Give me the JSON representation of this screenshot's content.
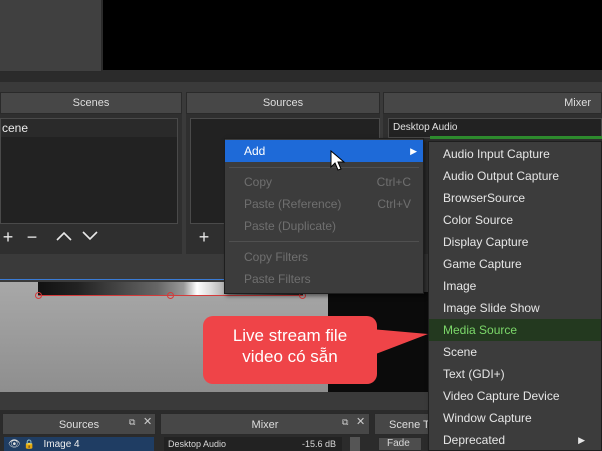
{
  "docks": {
    "scenes_title": "Scenes",
    "sources_title": "Sources",
    "mixer_title": "Mixer",
    "scene_item": "cene",
    "mixer_device": "Desktop Audio"
  },
  "context_menu": {
    "add": "Add",
    "copy": "Copy",
    "copy_shortcut": "Ctrl+C",
    "paste_ref": "Paste (Reference)",
    "paste_ref_shortcut": "Ctrl+V",
    "paste_dup": "Paste (Duplicate)",
    "copy_filters": "Copy Filters",
    "paste_filters": "Paste Filters"
  },
  "add_submenu": [
    "Audio Input Capture",
    "Audio Output Capture",
    "BrowserSource",
    "Color Source",
    "Display Capture",
    "Game Capture",
    "Image",
    "Image Slide Show",
    "Media Source",
    "Scene",
    "Text (GDI+)",
    "Video Capture Device",
    "Window Capture",
    "Deprecated"
  ],
  "callout": {
    "line1": "Live stream file",
    "line2": "video có sẵn"
  },
  "bottom": {
    "sources_title": "Sources",
    "mixer_title": "Mixer",
    "scene_t_title": "Scene T",
    "source_item": "Image 4",
    "mixer_device": "Desktop Audio",
    "mixer_db": "-15.6 dB",
    "fade_label": "Fade"
  },
  "colors": {
    "menu_highlight": "#1e6ad8",
    "submenu_highlight_text": "#7cd86a",
    "callout": "#ef4448",
    "selection": "#d43b3b"
  }
}
